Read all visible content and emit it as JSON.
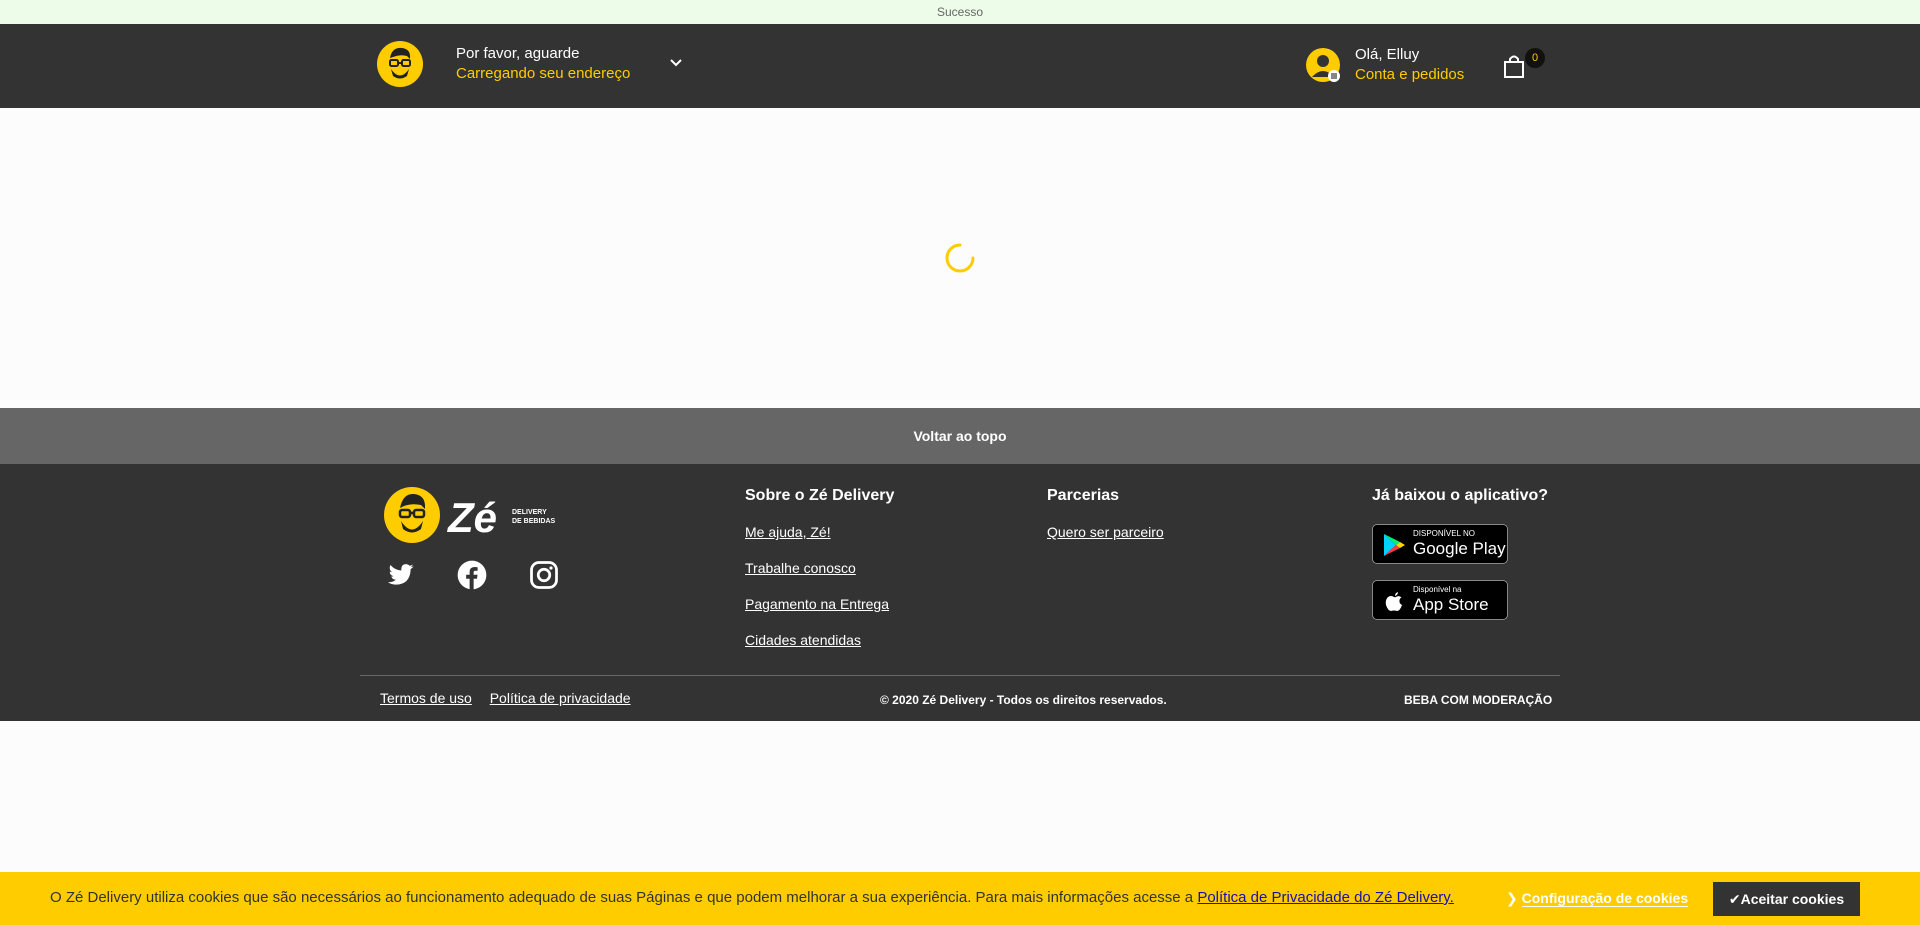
{
  "status_bar": {
    "text": "Sucesso"
  },
  "header": {
    "address_title": "Por favor, aguarde",
    "address_subtitle": "Carregando seu endereço",
    "user_greeting": "Olá, Elluy",
    "user_link": "Conta e pedidos",
    "cart_count": "0"
  },
  "back_to_top": "Voltar ao topo",
  "footer": {
    "about": {
      "title": "Sobre o Zé Delivery",
      "links": [
        "Me ajuda, Zé!",
        "Trabalhe conosco",
        "Pagamento na Entrega",
        "Cidades atendidas"
      ]
    },
    "partners": {
      "title": "Parcerias",
      "links": [
        "Quero ser parceiro"
      ]
    },
    "app": {
      "title": "Já baixou o aplicativo?",
      "google_small": "DISPONÍVEL NO",
      "google_big": "Google Play",
      "apple_small": "Disponível na",
      "apple_big": "App Store"
    },
    "logo_text": "Zé",
    "logo_tag1": "DELIVERY",
    "logo_tag2": "DE BEBIDAS",
    "terms": "Termos de uso",
    "privacy": "Política de privacidade",
    "copyright": "© 2020 Zé Delivery - Todos os direitos reservados.",
    "moderation": "BEBA COM MODERAÇÃO"
  },
  "cookie": {
    "text": "O Zé Delivery utiliza cookies que são necessários ao funcionamento adequado de suas Páginas e que podem melhorar a sua experiência. Para mais informações acesse a ",
    "link": "Política de Privacidade do Zé Delivery.",
    "config": "Configuração de cookies",
    "accept": "Aceitar cookies"
  },
  "colors": {
    "brand_yellow": "#ffcc00",
    "dark": "#333333",
    "success_bg": "#ecfce8"
  }
}
